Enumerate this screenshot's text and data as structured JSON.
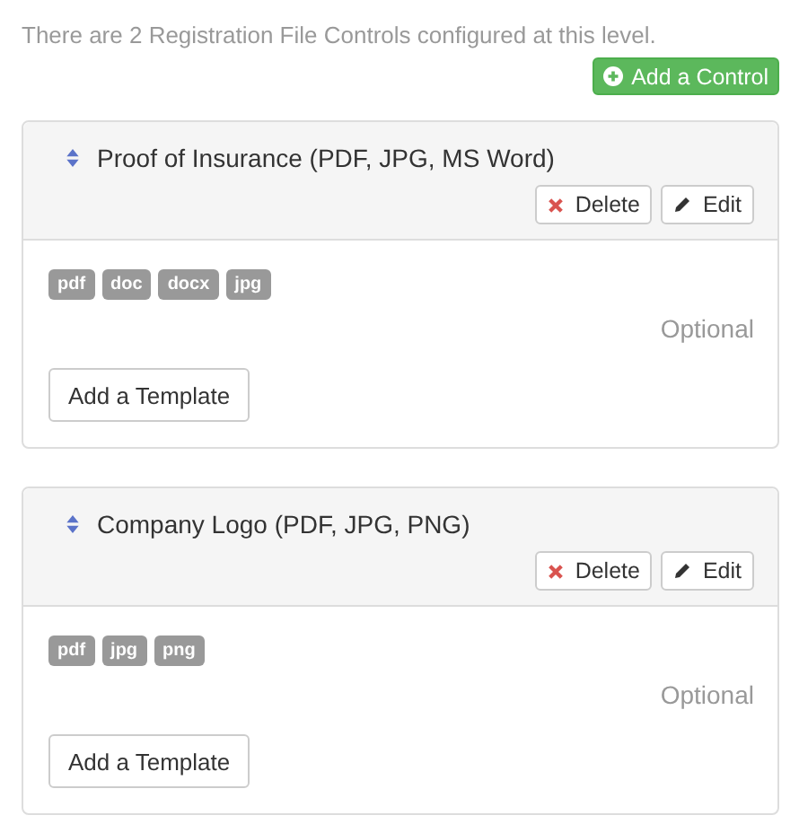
{
  "intro": "There are 2 Registration File Controls configured at this level.",
  "add_button": "Add a Control",
  "controls": [
    {
      "title": "Proof of Insurance (PDF, JPG, MS Word)",
      "delete": "Delete",
      "edit": "Edit",
      "file_types": [
        "pdf",
        "doc",
        "docx",
        "jpg"
      ],
      "requirement": "Optional",
      "template_button": "Add a Template"
    },
    {
      "title": "Company Logo (PDF, JPG, PNG)",
      "delete": "Delete",
      "edit": "Edit",
      "file_types": [
        "pdf",
        "jpg",
        "png"
      ],
      "requirement": "Optional",
      "template_button": "Add a Template"
    }
  ]
}
